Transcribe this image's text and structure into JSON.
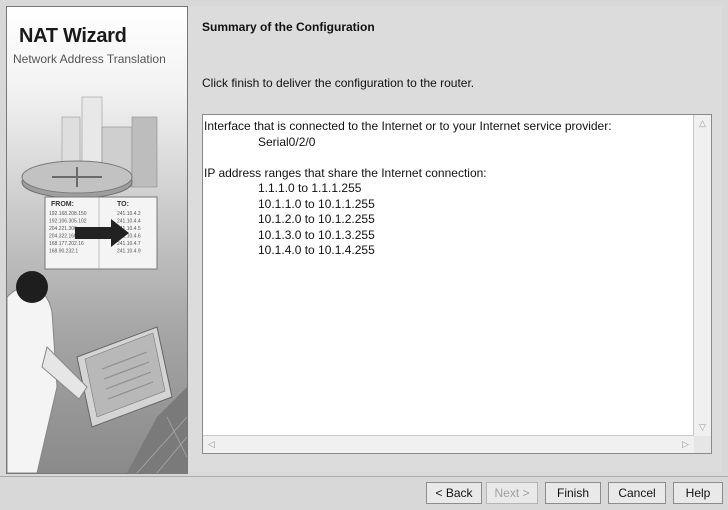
{
  "banner": {
    "title": "NAT Wizard",
    "subtitle": "Network Address Translation",
    "table": {
      "from_header": "FROM:",
      "to_header": "TO:",
      "from_rows": [
        "192.168.208.150",
        "192.106.305.102",
        "204.221.306",
        "204.322.160",
        "168.177.202.16",
        "168.90.232.1"
      ],
      "to_rows": [
        "241.10.4.2",
        "241.10.4.4",
        "241.10.4.5",
        "241.10.4.6",
        "241.10.4.7",
        "241.10.4.9"
      ]
    }
  },
  "content": {
    "title": "Summary of the Configuration",
    "instruction": "Click finish to deliver the configuration to the router."
  },
  "summary": {
    "interface_heading": "Interface that is connected to the Internet or to your Internet service provider:",
    "interface_value": "Serial0/2/0",
    "ranges_heading": "IP address ranges that share the Internet connection:",
    "ranges": [
      "1.1.1.0 to 1.1.1.255",
      "10.1.1.0 to 10.1.1.255",
      "10.1.2.0 to 10.1.2.255",
      "10.1.3.0 to 10.1.3.255",
      "10.1.4.0 to 10.1.4.255"
    ]
  },
  "buttons": {
    "back": "< Back",
    "next": "Next >",
    "finish": "Finish",
    "cancel": "Cancel",
    "help": "Help"
  },
  "icons": {
    "scroll_up": "chevron-up-icon",
    "scroll_down": "chevron-down-icon",
    "scroll_left": "chevron-left-icon",
    "scroll_right": "chevron-right-icon"
  }
}
